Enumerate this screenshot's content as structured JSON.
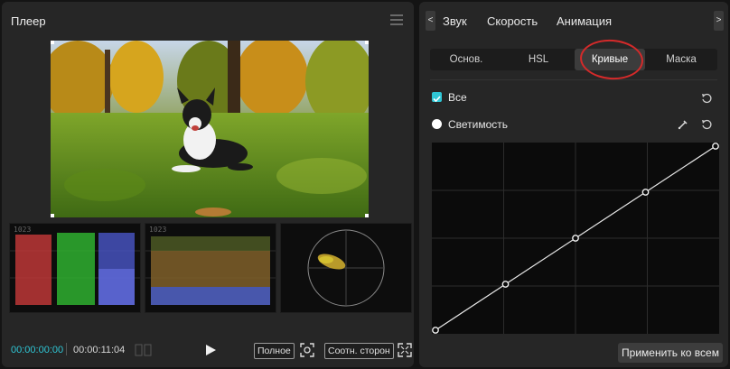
{
  "player": {
    "title": "Плеер",
    "scopes": {
      "waveform_rgb_label": "1023",
      "waveform_label": "1023"
    },
    "time_current": "00:00:00:00",
    "time_total": "00:00:11:04",
    "full_label": "Полное",
    "ratio_label": "Соотн. сторон"
  },
  "inspector": {
    "tabs": [
      "Звук",
      "Скорость",
      "Анимация"
    ],
    "arrow_left": "<",
    "arrow_right": ">",
    "subtabs": [
      "Основ.",
      "HSL",
      "Кривые",
      "Маска"
    ],
    "active_subtab": "Кривые",
    "all_label": "Все",
    "luma_label": "Светимость",
    "apply_label": "Применить ко всем",
    "accent_color": "#2fc6d5",
    "highlight_color": "#d42a2a",
    "curve_points": [
      [
        0,
        0
      ],
      [
        0.25,
        0.25
      ],
      [
        0.5,
        0.5
      ],
      [
        0.75,
        0.75
      ],
      [
        1,
        1
      ]
    ]
  }
}
